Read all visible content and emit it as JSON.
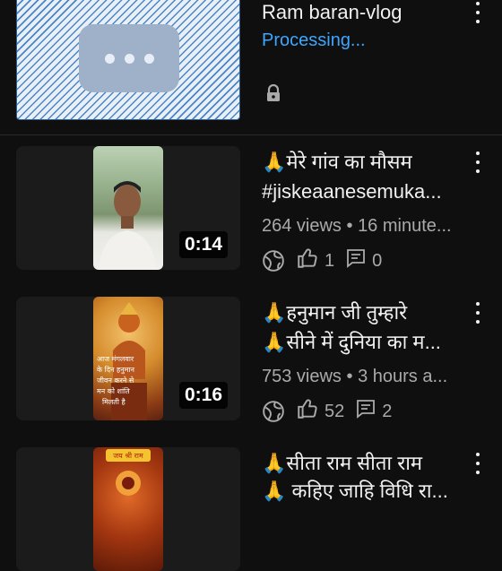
{
  "processing_item": {
    "title": "Ram baran-vlog",
    "status": "Processing...",
    "thumbnail_icon": "more-horizontal-icon",
    "visibility_icon": "lock-icon",
    "colors": {
      "status": "#3ea6ff",
      "stripe": "#4a86c7"
    }
  },
  "videos": [
    {
      "title_line1": "🙏मेरे गांव का मौसम",
      "title_line2": "#jiskeaanesemuka...",
      "views": "264 views",
      "separator": " • ",
      "time": "16 minute...",
      "duration": "0:14",
      "likes": "1",
      "comments": "0"
    },
    {
      "title_line1": "🙏हनुमान जी तुम्हारे",
      "title_line2": "🙏सीने में दुनिया का म...",
      "views": "753 views",
      "separator": " • ",
      "time": "3 hours a...",
      "duration": "0:16",
      "likes": "52",
      "comments": "2",
      "thumb_text": "आज मंगलवार के दिन हनुमान जीवन करने से मन को शांति मिलती है"
    },
    {
      "title_line1": "🙏सीता राम सीता राम",
      "title_line2": "🙏 कहिए जाहि विधि रा...",
      "thumb_text": "जय श्री राम"
    }
  ],
  "icons": {
    "visibility": "globe-icon",
    "like": "thumbs-up-icon",
    "comment": "comment-icon",
    "menu": "more-vertical-icon"
  }
}
